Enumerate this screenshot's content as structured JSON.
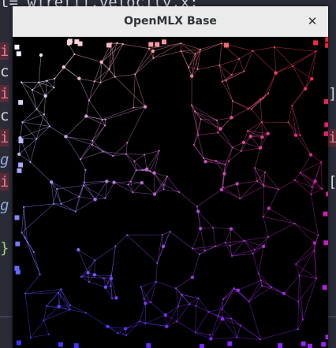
{
  "window": {
    "title": "OpenMLX Base",
    "close_glyph": "✕"
  },
  "editor": {
    "top_line": "t= wire[i].velocity.x;",
    "lines": [
      {
        "text": "i"
      },
      {
        "text": "c"
      },
      {
        "text": "i"
      },
      {
        "text": "c"
      },
      {
        "text": "i"
      },
      {
        "text": "g"
      },
      {
        "text": "i"
      },
      {
        "text": "g"
      },
      {
        "text": "}"
      }
    ],
    "right_fragments": [
      "]",
      "i",
      "["
    ]
  },
  "canvas": {
    "description_icon": "particle-mesh-icon",
    "colors": {
      "top_left": "#ffffff",
      "top_right": "#ff2030",
      "bottom_left": "#3030ff",
      "bottom_right": "#a020ff"
    }
  }
}
